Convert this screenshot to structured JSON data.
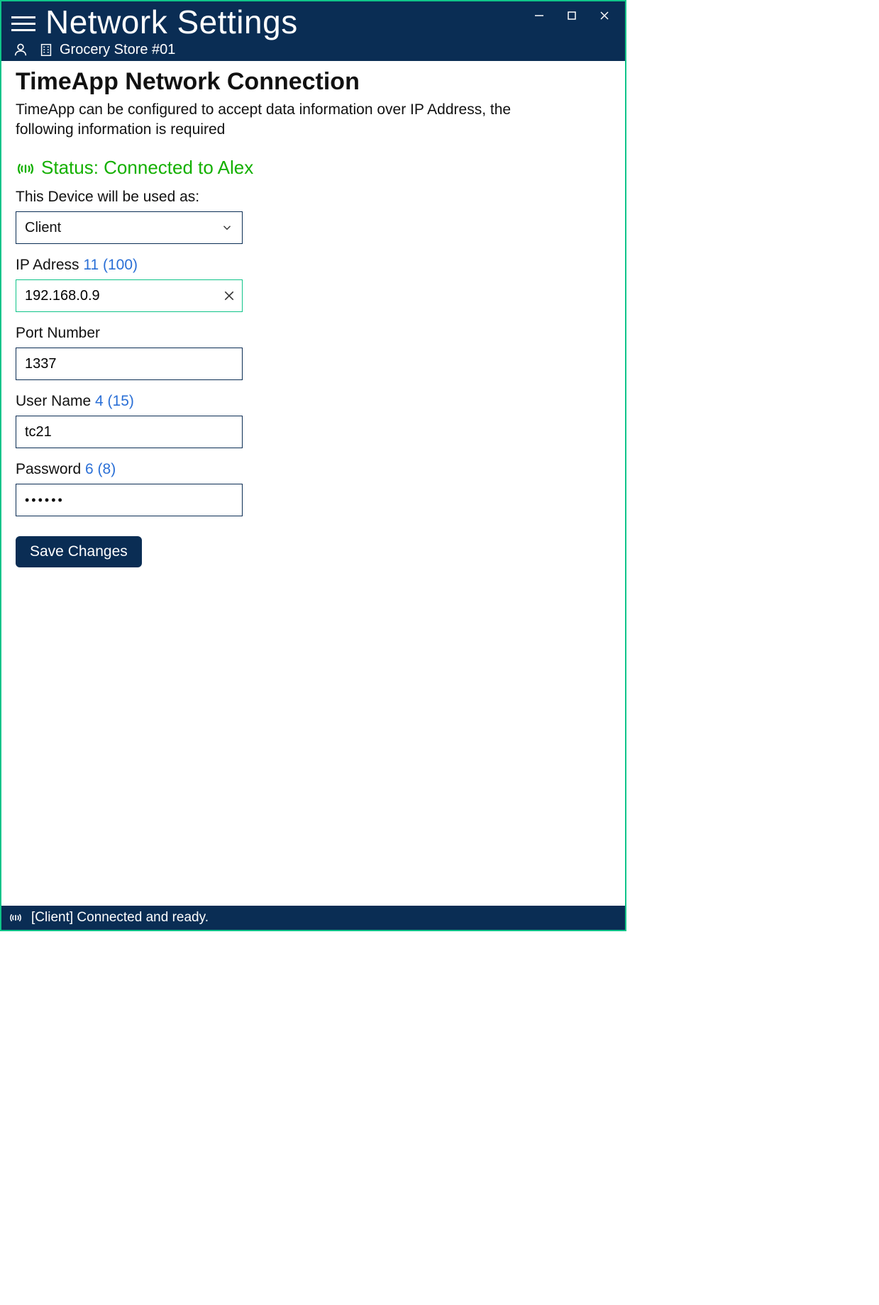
{
  "window": {
    "title": "Network Settings",
    "location": "Grocery Store #01"
  },
  "page": {
    "heading": "TimeApp Network Connection",
    "description": "TimeApp can be configured to accept data information over IP Address, the following information is required"
  },
  "status": {
    "text": "Status: Connected to Alex",
    "color": "#14b000"
  },
  "form": {
    "device_label": "This Device will be used as:",
    "device_value": "Client",
    "ip": {
      "label": "IP Adress",
      "counter": "11 (100)",
      "value": "192.168.0.9",
      "active": true
    },
    "port": {
      "label": "Port Number",
      "value": "1337"
    },
    "user": {
      "label": "User Name",
      "counter": "4 (15)",
      "value": "tc21"
    },
    "password": {
      "label": "Password",
      "counter": "6 (8)",
      "masked": "••••••"
    },
    "save_label": "Save Changes"
  },
  "statusbar": {
    "text": "[Client] Connected and ready."
  }
}
